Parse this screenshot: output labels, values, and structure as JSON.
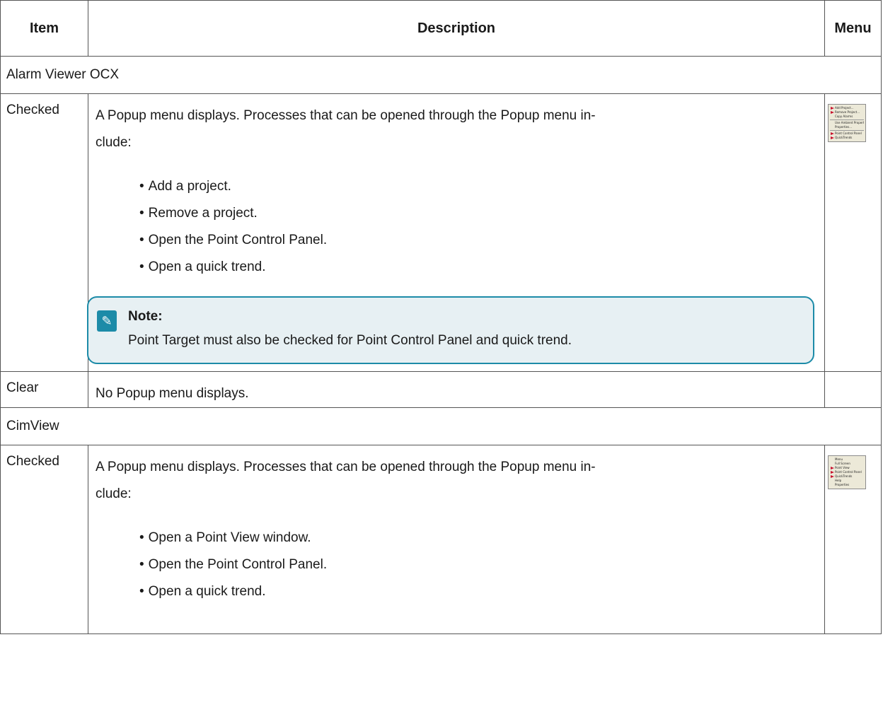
{
  "header": {
    "item": "Item",
    "description": "Description",
    "menu": "Menu"
  },
  "groups": [
    {
      "title": "Alarm Viewer OCX",
      "rows": [
        {
          "item": "Checked",
          "desc_line1": "A Popup menu displays. Processes that can be opened through the Popup menu in-",
          "desc_line2": "clude:",
          "bullets": [
            "Add a project.",
            "Remove a project.",
            "Open the Point Control Panel.",
            "Open a quick trend."
          ],
          "note": {
            "title": "Note:",
            "text": "Point Target must also be checked for Point Control Panel and quick trend."
          },
          "menu_items": [
            "Add Project...",
            "Remove Project...",
            "Copy Alarms",
            "Use Ambient Properties",
            "Properties...",
            "Point Control Panel",
            "QuickTrends"
          ]
        },
        {
          "item": "Clear",
          "desc": "No Popup menu displays."
        }
      ]
    },
    {
      "title": "CimView",
      "rows": [
        {
          "item": "Checked",
          "desc_line1": "A Popup menu displays. Processes that can be opened through the Popup menu in-",
          "desc_line2": "clude:",
          "bullets": [
            "Open a Point View window.",
            "Open the Point Control Panel.",
            "Open a quick trend."
          ],
          "menu_items": [
            "Menu",
            "Full Screen",
            "Point View",
            "Point Control Panel",
            "QuickTrends",
            "Help",
            "Properties"
          ]
        }
      ]
    }
  ],
  "colors": {
    "note_border": "#1c8ba8",
    "note_bg": "#e7f0f3",
    "menu_arrow": "#c8102e"
  },
  "icons": {
    "note": "pencil-clipboard-icon"
  }
}
